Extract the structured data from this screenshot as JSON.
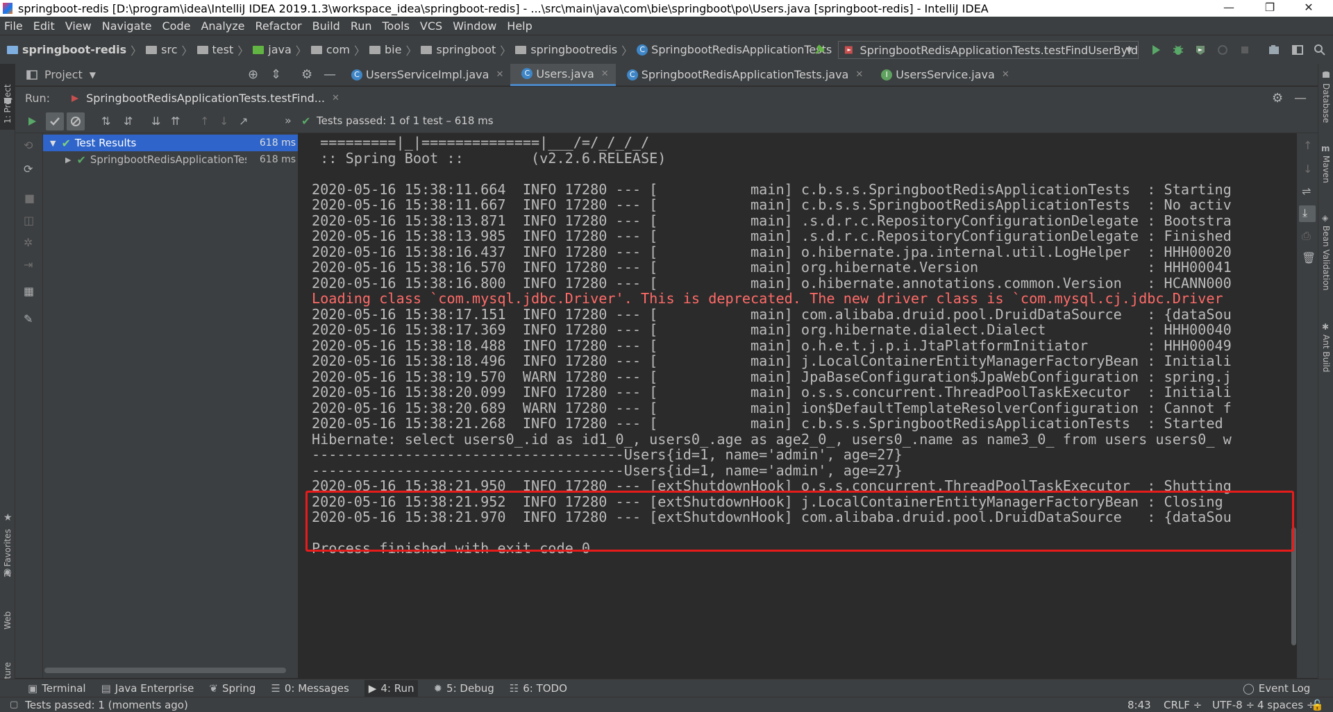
{
  "window": {
    "title": "springboot-redis [D:\\program\\idea\\IntelliJ IDEA 2019.1.3\\workspace_idea\\springboot-redis] - ...\\src\\main\\java\\com\\bie\\springboot\\po\\Users.java [springboot-redis] - IntelliJ IDEA",
    "minimize": "—",
    "restore": "❐",
    "close": "✕"
  },
  "menu": [
    "File",
    "Edit",
    "View",
    "Navigate",
    "Code",
    "Analyze",
    "Refactor",
    "Build",
    "Run",
    "Tools",
    "VCS",
    "Window",
    "Help"
  ],
  "breadcrumbs": [
    "springboot-redis",
    "src",
    "test",
    "java",
    "com",
    "bie",
    "springboot",
    "springbootredis",
    "SpringbootRedisApplicationTests"
  ],
  "run_config": {
    "label": "SpringbootRedisApplicationTests.testFindUserById",
    "caret": "▼"
  },
  "project_panel": {
    "label": "Project",
    "caret": "▼"
  },
  "editor_tabs": [
    {
      "label": "UsersServiceImpl.java",
      "kind": "class"
    },
    {
      "label": "Users.java",
      "kind": "class",
      "active": true
    },
    {
      "label": "SpringbootRedisApplicationTests.java",
      "kind": "class"
    },
    {
      "label": "UsersService.java",
      "kind": "interface"
    }
  ],
  "run": {
    "label": "Run:",
    "tab_label": "SpringbootRedisApplicationTests.testFind...",
    "status": "Tests passed: 1 of 1 test – 618 ms",
    "more": "»"
  },
  "tests": {
    "root": {
      "label": "Test Results",
      "time": "618 ms"
    },
    "child": {
      "label": "SpringbootRedisApplicationTes",
      "time": "618 ms"
    }
  },
  "console": {
    "lines": [
      {
        "text": " =========|_|==============|___/=/_/_/_/",
        "style": "normal"
      },
      {
        "text": " :: Spring Boot ::        (v2.2.6.RELEASE)",
        "style": "normal"
      },
      {
        "text": "",
        "style": "normal"
      },
      {
        "text": "2020-05-16 15:38:11.664  INFO 17280 --- [           main] c.b.s.s.SpringbootRedisApplicationTests  : Starting",
        "style": "normal"
      },
      {
        "text": "2020-05-16 15:38:11.667  INFO 17280 --- [           main] c.b.s.s.SpringbootRedisApplicationTests  : No activ",
        "style": "normal"
      },
      {
        "text": "2020-05-16 15:38:13.871  INFO 17280 --- [           main] .s.d.r.c.RepositoryConfigurationDelegate : Bootstra",
        "style": "normal"
      },
      {
        "text": "2020-05-16 15:38:13.985  INFO 17280 --- [           main] .s.d.r.c.RepositoryConfigurationDelegate : Finished",
        "style": "normal"
      },
      {
        "text": "2020-05-16 15:38:16.437  INFO 17280 --- [           main] o.hibernate.jpa.internal.util.LogHelper  : HHH00020",
        "style": "normal"
      },
      {
        "text": "2020-05-16 15:38:16.570  INFO 17280 --- [           main] org.hibernate.Version                    : HHH00041",
        "style": "normal"
      },
      {
        "text": "2020-05-16 15:38:16.800  INFO 17280 --- [           main] o.hibernate.annotations.common.Version   : HCANN000",
        "style": "normal"
      },
      {
        "text": "Loading class `com.mysql.jdbc.Driver'. This is deprecated. The new driver class is `com.mysql.cj.jdbc.Driver",
        "style": "error"
      },
      {
        "text": "2020-05-16 15:38:17.151  INFO 17280 --- [           main] com.alibaba.druid.pool.DruidDataSource   : {dataSou",
        "style": "normal"
      },
      {
        "text": "2020-05-16 15:38:17.369  INFO 17280 --- [           main] org.hibernate.dialect.Dialect            : HHH00040",
        "style": "normal"
      },
      {
        "text": "2020-05-16 15:38:18.488  INFO 17280 --- [           main] o.h.e.t.j.p.i.JtaPlatformInitiator       : HHH00049",
        "style": "normal"
      },
      {
        "text": "2020-05-16 15:38:18.496  INFO 17280 --- [           main] j.LocalContainerEntityManagerFactoryBean : Initiali",
        "style": "normal"
      },
      {
        "text": "2020-05-16 15:38:19.570  WARN 17280 --- [           main] JpaBaseConfiguration$JpaWebConfiguration : spring.j",
        "style": "normal"
      },
      {
        "text": "2020-05-16 15:38:20.099  INFO 17280 --- [           main] o.s.s.concurrent.ThreadPoolTaskExecutor  : Initiali",
        "style": "normal"
      },
      {
        "text": "2020-05-16 15:38:20.689  WARN 17280 --- [           main] ion$DefaultTemplateResolverConfiguration : Cannot f",
        "style": "normal"
      },
      {
        "text": "2020-05-16 15:38:21.268  INFO 17280 --- [           main] c.b.s.s.SpringbootRedisApplicationTests  : Started",
        "style": "normal"
      },
      {
        "text": "Hibernate: select users0_.id as id1_0_, users0_.age as age2_0_, users0_.name as name3_0_ from users users0_ w",
        "style": "normal"
      },
      {
        "text": "-------------------------------------Users{id=1, name='admin', age=27}",
        "style": "normal"
      },
      {
        "text": "-------------------------------------Users{id=1, name='admin', age=27}",
        "style": "normal"
      },
      {
        "text": "2020-05-16 15:38:21.950  INFO 17280 --- [extShutdownHook] o.s.s.concurrent.ThreadPoolTaskExecutor  : Shutting",
        "style": "normal"
      },
      {
        "text": "2020-05-16 15:38:21.952  INFO 17280 --- [extShutdownHook] j.LocalContainerEntityManagerFactoryBean : Closing",
        "style": "normal"
      },
      {
        "text": "2020-05-16 15:38:21.970  INFO 17280 --- [extShutdownHook] com.alibaba.druid.pool.DruidDataSource   : {dataSou",
        "style": "normal"
      },
      {
        "text": "",
        "style": "normal"
      },
      {
        "text": "Process finished with exit code 0",
        "style": "normal"
      }
    ]
  },
  "left_stripe": {
    "project": "1: Project",
    "favorites": "2: Favorites",
    "web": "Web",
    "structure": "Z: Structure"
  },
  "right_stripe": {
    "database": "Database",
    "maven": "Maven",
    "bean_validation": "Bean Validation",
    "ant_build": "Ant Build"
  },
  "bottom_tools": [
    {
      "label": "Terminal",
      "icon": "terminal-icon"
    },
    {
      "label": "Java Enterprise",
      "icon": "java-enterprise-icon"
    },
    {
      "label": "Spring",
      "icon": "spring-icon"
    },
    {
      "label": "0: Messages",
      "icon": "messages-icon"
    },
    {
      "label": "4: Run",
      "icon": "run-icon",
      "active": true
    },
    {
      "label": "5: Debug",
      "icon": "debug-icon"
    },
    {
      "label": "6: TODO",
      "icon": "todo-icon"
    }
  ],
  "event_log": "Event Log",
  "status": {
    "message": "Tests passed: 1 (moments ago)",
    "position": "8:43",
    "line_sep": "CRLF ÷",
    "encoding": "UTF-8 ÷",
    "indent": "4 spaces ÷"
  },
  "colors": {
    "accent": "#4a88c7",
    "success": "#59a869",
    "error": "#ff6b68",
    "highlight_box": "#e81b1b"
  }
}
